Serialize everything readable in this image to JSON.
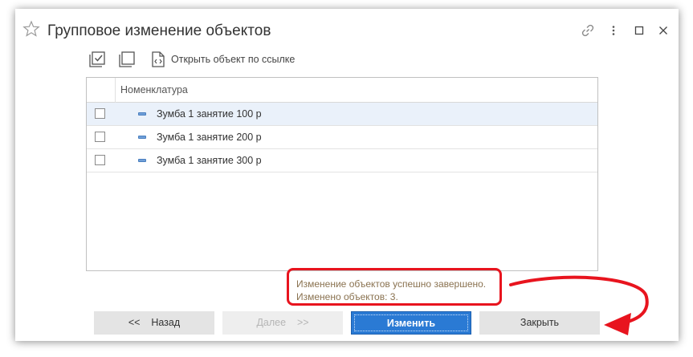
{
  "window": {
    "title": "Групповое изменение объектов"
  },
  "toolbar": {
    "open_by_link_label": "Открыть объект по ссылке"
  },
  "table": {
    "column_header": "Номенклатура",
    "rows": [
      {
        "label": "Зумба 1 занятие 100 р",
        "checked": false,
        "selected": true
      },
      {
        "label": "Зумба 1 занятие 200 р",
        "checked": false,
        "selected": false
      },
      {
        "label": "Зумба 1 занятие 300 р",
        "checked": false,
        "selected": false
      }
    ]
  },
  "status": {
    "line1": "Изменение объектов успешно завершено.",
    "line2": "Изменено объектов: 3."
  },
  "buttons": {
    "back_label": "<<    Назад",
    "next_label": "Далее    >>",
    "change_label": "Изменить",
    "close_label": "Закрыть"
  },
  "colors": {
    "accent": "#2a7ad4",
    "annotation": "#e8141e",
    "status_text": "#8a7250"
  }
}
